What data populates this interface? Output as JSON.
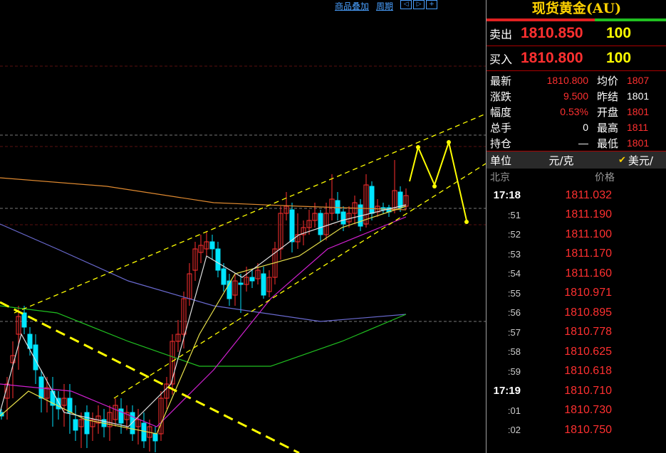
{
  "toolbar": {
    "overlay_label": "商品叠加",
    "period_label": "周期",
    "nav_buttons": [
      "◁",
      "▷",
      "+"
    ]
  },
  "panel": {
    "title": "现货黄金(AU)",
    "sell": {
      "label": "卖出",
      "price": "1810.850",
      "volume": "100"
    },
    "buy": {
      "label": "买入",
      "price": "1810.800",
      "volume": "100"
    },
    "stats": [
      {
        "k1": "最新",
        "v1": "1810.800",
        "k2": "均价",
        "v2": "1807"
      },
      {
        "k1": "涨跌",
        "v1": "9.500",
        "k2": "昨结",
        "v2": "1801"
      },
      {
        "k1": "幅度",
        "v1": "0.53%",
        "k2": "开盘",
        "v2": "1801"
      },
      {
        "k1": "总手",
        "v1": "0",
        "k2": "最高",
        "v2": "1811"
      },
      {
        "k1": "持仓",
        "v1": "—",
        "k2": "最低",
        "v2": "1801"
      }
    ],
    "unit": {
      "label": "单位",
      "value": "元/克",
      "check": "✔",
      "currency": "美元/"
    },
    "tick_header": {
      "location": "北京",
      "price": "价格"
    },
    "ticks": [
      {
        "time": "17:18",
        "price": "1811.032"
      },
      {
        "time": ":51",
        "price": "1811.190"
      },
      {
        "time": ":52",
        "price": "1811.100"
      },
      {
        "time": ":53",
        "price": "1811.170"
      },
      {
        "time": ":54",
        "price": "1811.160"
      },
      {
        "time": ":55",
        "price": "1810.971"
      },
      {
        "time": ":56",
        "price": "1810.895"
      },
      {
        "time": ":57",
        "price": "1810.778"
      },
      {
        "time": ":58",
        "price": "1810.625"
      },
      {
        "time": ":59",
        "price": "1810.618"
      },
      {
        "time": "17:19",
        "price": "1810.710"
      },
      {
        "time": ":01",
        "price": "1810.730"
      },
      {
        "time": ":02",
        "price": "1810.750"
      }
    ]
  },
  "colors": {
    "up": "#ff3030",
    "down": "#00e5ff",
    "ma_white": "#e0e0e0",
    "ma_yellow": "#e8e04a",
    "ma_magenta": "#d020d0",
    "ma_green": "#20c020",
    "ma_blue": "#6a6ad0",
    "ma_orange": "#e08a30",
    "trend": "#ffff00"
  }
}
